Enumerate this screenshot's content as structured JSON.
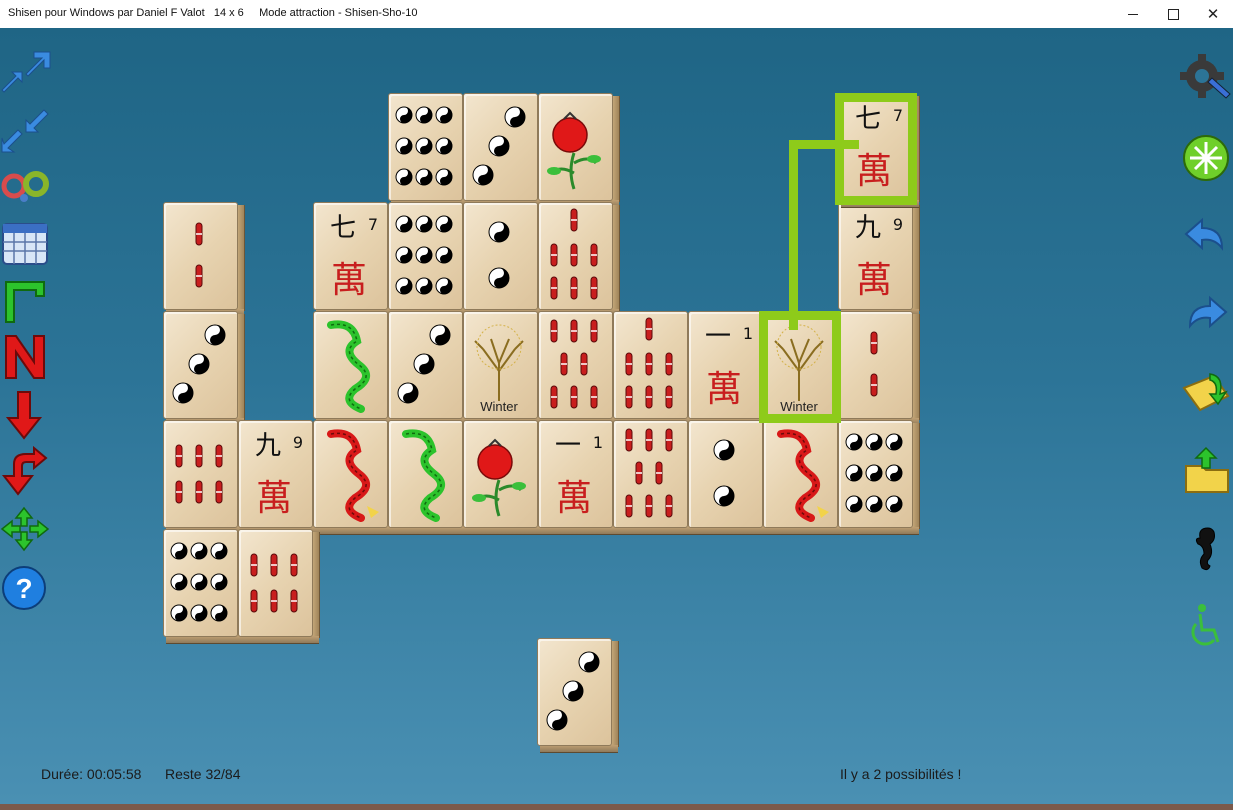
{
  "window": {
    "title": "Shisen pour Windows par Daniel F Valot   14 x 6     Mode attraction - Shisen-Sho-10",
    "min_label": "minimize",
    "max_label": "maximize",
    "close_label": "✕"
  },
  "colors": {
    "board_top": "#1f6585",
    "board_bottom": "#4a90b3",
    "highlight": "#8ecb1a",
    "red_glyph": "#c81e1e"
  },
  "left_toolbar": [
    {
      "name": "move-up-diagonal-icon"
    },
    {
      "name": "move-down-diagonal-icon"
    },
    {
      "name": "gears-icon"
    },
    {
      "name": "calendar-grid-icon"
    },
    {
      "name": "gravity-l-icon"
    },
    {
      "name": "new-game-n-icon"
    },
    {
      "name": "arrow-down-icon"
    },
    {
      "name": "undo-down-icon"
    },
    {
      "name": "shuffle-cross-icon"
    },
    {
      "name": "help-icon",
      "label": "?"
    }
  ],
  "right_toolbar": [
    {
      "name": "settings-wrench-icon"
    },
    {
      "name": "hint-star-icon"
    },
    {
      "name": "undo-arrow-icon"
    },
    {
      "name": "redo-arrow-icon"
    },
    {
      "name": "open-folder-icon"
    },
    {
      "name": "save-folder-icon"
    },
    {
      "name": "seahorse-icon"
    },
    {
      "name": "accessibility-icon"
    }
  ],
  "tiles": [
    {
      "name": "tile-circle-9",
      "suit": "circle",
      "value": 9
    },
    {
      "name": "tile-circle-3",
      "suit": "circle",
      "value": 3
    },
    {
      "name": "tile-pomegranate",
      "suit": "flower"
    },
    {
      "name": "tile-bamboo-2",
      "suit": "bamboo",
      "value": 2
    },
    {
      "name": "tile-character-7",
      "suit": "character",
      "value": 7,
      "label": "七"
    },
    {
      "name": "tile-circle-9",
      "suit": "circle",
      "value": 9
    },
    {
      "name": "tile-circle-2",
      "suit": "circle",
      "value": 2
    },
    {
      "name": "tile-bamboo-7",
      "suit": "bamboo",
      "value": 7
    },
    {
      "name": "tile-character-9",
      "suit": "character",
      "value": 9,
      "label": "九"
    },
    {
      "name": "tile-circle-3",
      "suit": "circle",
      "value": 3
    },
    {
      "name": "tile-green-dragon",
      "suit": "dragon"
    },
    {
      "name": "tile-circle-3",
      "suit": "circle",
      "value": 3
    },
    {
      "name": "tile-winter",
      "suit": "season",
      "label": "Winter"
    },
    {
      "name": "tile-bamboo-8",
      "suit": "bamboo",
      "value": 8
    },
    {
      "name": "tile-bamboo-7",
      "suit": "bamboo",
      "value": 7
    },
    {
      "name": "tile-character-1",
      "suit": "character",
      "value": 1,
      "label": "一"
    },
    {
      "name": "tile-winter",
      "suit": "season",
      "label": "Winter"
    },
    {
      "name": "tile-bamboo-2",
      "suit": "bamboo",
      "value": 2
    },
    {
      "name": "tile-bamboo-6",
      "suit": "bamboo",
      "value": 6
    },
    {
      "name": "tile-character-9",
      "suit": "character",
      "value": 9,
      "label": "九"
    },
    {
      "name": "tile-red-dragon",
      "suit": "dragon"
    },
    {
      "name": "tile-green-dragon",
      "suit": "dragon"
    },
    {
      "name": "tile-pomegranate",
      "suit": "flower"
    },
    {
      "name": "tile-character-1",
      "suit": "character",
      "value": 1,
      "label": "一"
    },
    {
      "name": "tile-bamboo-8",
      "suit": "bamboo",
      "value": 8
    },
    {
      "name": "tile-circle-2",
      "suit": "circle",
      "value": 2
    },
    {
      "name": "tile-red-dragon",
      "suit": "dragon"
    },
    {
      "name": "tile-circle-9",
      "suit": "circle",
      "value": 9
    },
    {
      "name": "tile-circle-9",
      "suit": "circle",
      "value": 9
    },
    {
      "name": "tile-bamboo-6",
      "suit": "bamboo",
      "value": 6
    },
    {
      "name": "tile-character-7",
      "suit": "character",
      "value": 7,
      "label": "七"
    },
    {
      "name": "tile-circle-3",
      "suit": "circle",
      "value": 3
    }
  ],
  "character_glyph": "萬",
  "status": {
    "duration": "Durée: 00:05:58",
    "remaining": "Reste 32/84",
    "message": "Il y a 2 possibilités !"
  }
}
